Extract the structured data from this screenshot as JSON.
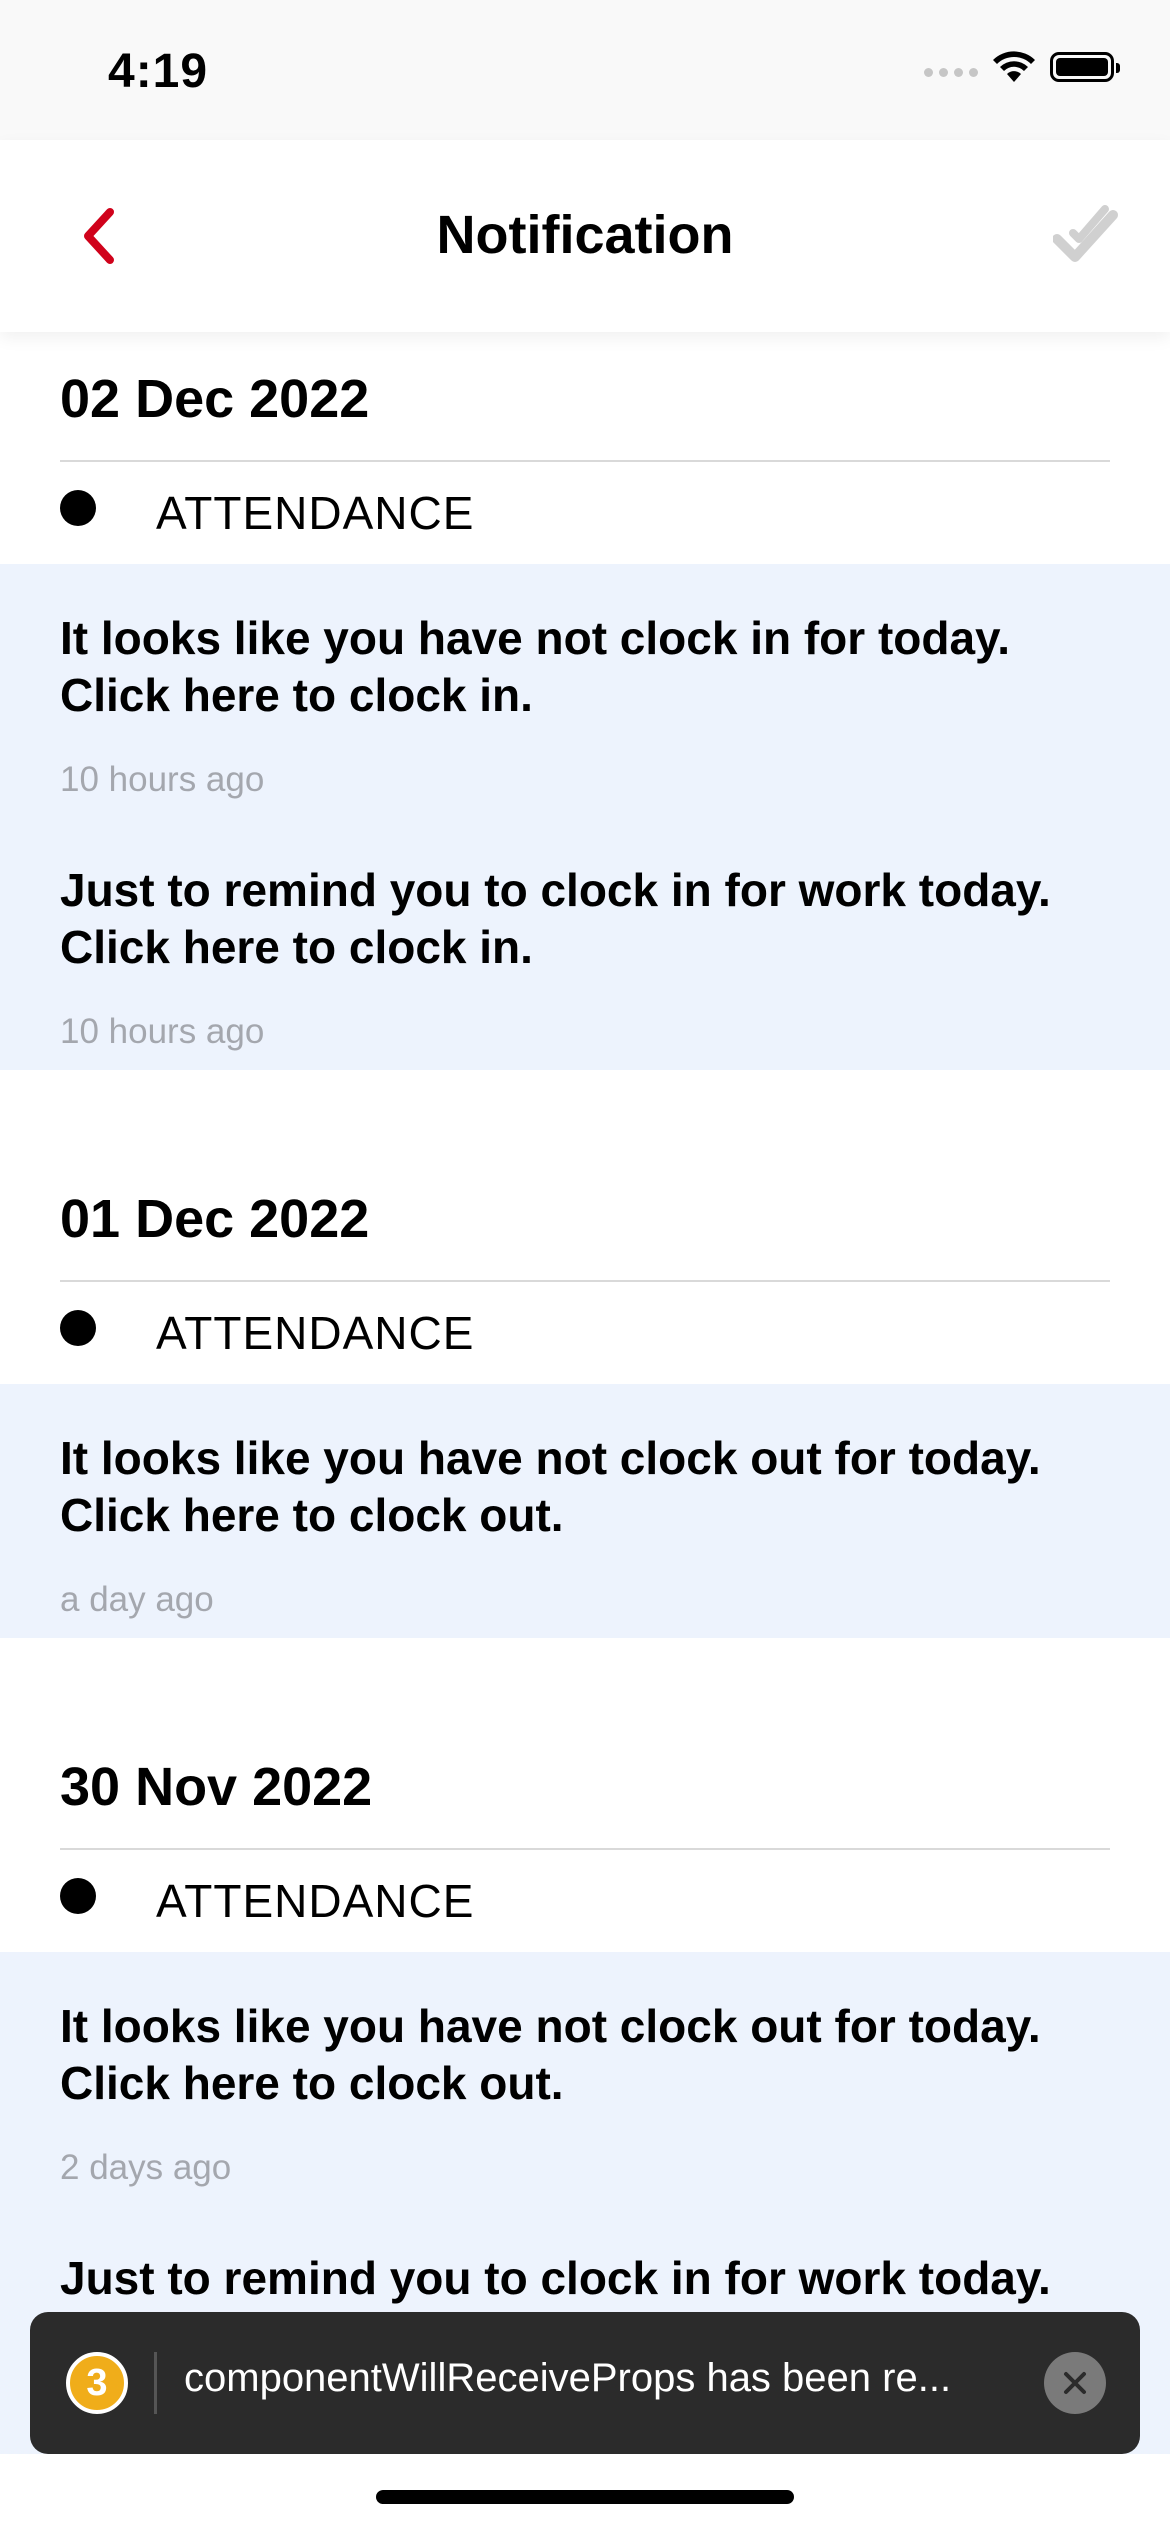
{
  "status_bar": {
    "time": "4:19"
  },
  "header": {
    "title": "Notification",
    "back_icon": "chevron-left-icon",
    "action_icon": "double-check-icon",
    "accent_color": "#d0021b"
  },
  "sections": [
    {
      "date": "02 Dec 2022",
      "category": "ATTENDANCE",
      "items": [
        {
          "message": "It looks like you have not clock in for today. Click here to clock in.",
          "time": "10 hours ago"
        },
        {
          "message": "Just to remind you to clock in for work today. Click here to clock in.",
          "time": "10 hours ago"
        }
      ]
    },
    {
      "date": "01 Dec 2022",
      "category": "ATTENDANCE",
      "items": [
        {
          "message": "It looks like you have not clock out for today. Click here to clock out.",
          "time": "a day ago"
        }
      ]
    },
    {
      "date": "30 Nov 2022",
      "category": "ATTENDANCE",
      "items": [
        {
          "message": "It looks like you have not clock out for today. Click here to clock out.",
          "time": "2 days ago"
        },
        {
          "message": "Just to remind you to clock in for work today. Click here to clock in.",
          "time": ""
        }
      ]
    }
  ],
  "toast": {
    "count": "3",
    "message": "componentWillReceiveProps has been re..."
  }
}
